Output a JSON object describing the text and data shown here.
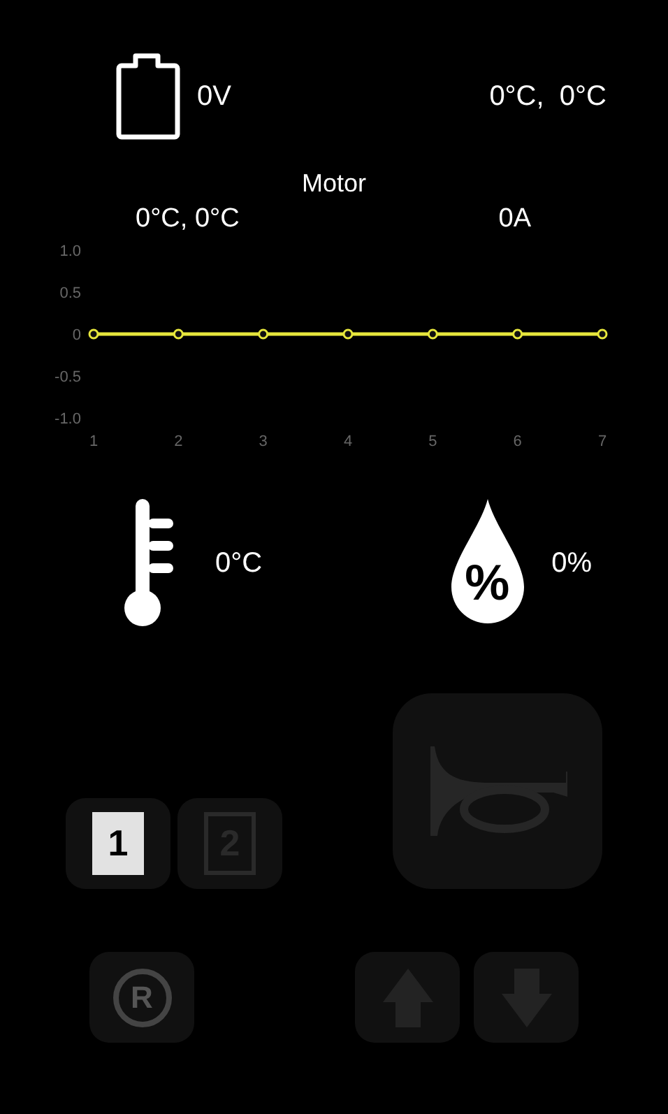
{
  "battery": {
    "voltage": "0V"
  },
  "top_temps": "0°C,  0°C",
  "motor": {
    "title": "Motor",
    "temps": "0°C, 0°C",
    "current": "0A",
    "chart_data": {
      "type": "line",
      "x": [
        1,
        2,
        3,
        4,
        5,
        6,
        7
      ],
      "series": [
        {
          "color": "#e6e63c",
          "marker": "circle",
          "values": [
            0,
            0,
            0,
            0,
            0,
            0,
            0
          ]
        }
      ],
      "xticks": [
        1,
        2,
        3,
        4,
        5,
        6,
        7
      ],
      "xlim": [
        1,
        7
      ],
      "ylim": [
        -1,
        1
      ],
      "yticks": [
        {
          "value": 1,
          "label": "1.0"
        },
        {
          "value": 0.5,
          "label": "0.5"
        },
        {
          "value": 0,
          "label": "0"
        },
        {
          "value": -0.5,
          "label": "-0.5"
        },
        {
          "value": -1,
          "label": "-1.0"
        }
      ]
    }
  },
  "temperature": {
    "reading": "0°C"
  },
  "humidity": {
    "symbol": "%",
    "reading": "0%"
  },
  "gears": [
    {
      "label": "1",
      "selected": true
    },
    {
      "label": "2",
      "selected": false
    }
  ],
  "reverse": {
    "label": "R"
  }
}
